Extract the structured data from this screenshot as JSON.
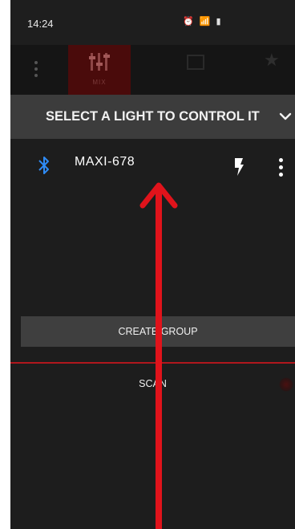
{
  "status_bar": {
    "time": "14:24",
    "icons": [
      "alarm-icon",
      "wifi-icon",
      "volte-icon",
      "signal-icon",
      "battery-icon"
    ]
  },
  "nav": {
    "tabs": [
      {
        "label": "MIX",
        "icon": "sliders-icon",
        "active": true
      },
      {
        "label": "",
        "icon": "square-icon",
        "active": false
      },
      {
        "label": "",
        "icon": "star-icon",
        "active": false
      }
    ]
  },
  "header": {
    "title": "SELECT A LIGHT TO CONTROL IT"
  },
  "device": {
    "name": "MAXI-678",
    "connection_icon": "bluetooth-icon"
  },
  "actions": {
    "create_group": "CREATE GROUP",
    "scan": "SCAN"
  },
  "colors": {
    "accent_red": "#e0131b",
    "bluetooth_blue": "#2f8bf5",
    "background": "#1d1d1d",
    "header_bg": "#3c3c3c"
  }
}
